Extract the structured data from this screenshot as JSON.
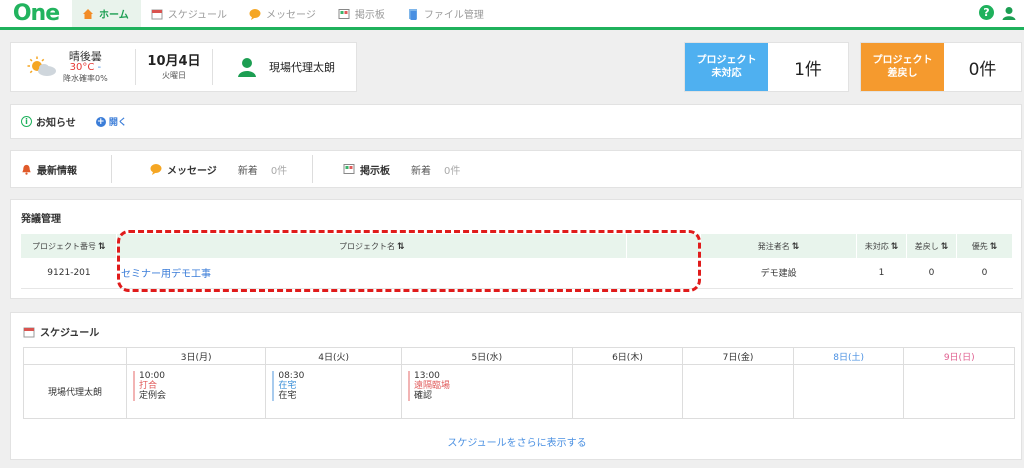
{
  "app": {
    "logo": "One"
  },
  "nav": [
    {
      "label": "ホーム",
      "icon": "home-icon",
      "active": true
    },
    {
      "label": "スケジュール",
      "icon": "calendar-icon"
    },
    {
      "label": "メッセージ",
      "icon": "chat-icon"
    },
    {
      "label": "掲示板",
      "icon": "board-icon"
    },
    {
      "label": "ファイル管理",
      "icon": "file-icon"
    }
  ],
  "weather": {
    "desc": "晴後曇",
    "temp": "30°C",
    "temp_min": "-",
    "rain": "降水確率0%"
  },
  "date": {
    "day": "10月4日",
    "weekday": "火曜日"
  },
  "user": {
    "name": "現場代理太朗"
  },
  "project_unhandled": {
    "label_line1": "プロジェクト",
    "label_line2": "未対応",
    "value": "1件",
    "color": "#4fb0f0"
  },
  "project_returned": {
    "label_line1": "プロジェクト",
    "label_line2": "差戻し",
    "value": "0件",
    "color": "#f59a2e"
  },
  "notice": {
    "title": "お知らせ",
    "open": "開く"
  },
  "latest": {
    "title": "最新情報",
    "message_label": "メッセージ",
    "message_new": "新着",
    "message_count": "0件",
    "board_label": "掲示板",
    "board_new": "新着",
    "board_count": "0件"
  },
  "orders": {
    "title": "発議管理",
    "columns": [
      "プロジェクト番号",
      "プロジェクト名",
      "",
      "発注者名",
      "未対応",
      "差戻し",
      "優先"
    ],
    "rows": [
      {
        "number": "9121-201",
        "name": "セミナー用デモ工事",
        "client": "デモ建設",
        "unhandled": "1",
        "returned": "0",
        "priority": "0"
      }
    ]
  },
  "schedule": {
    "title": "スケジュール",
    "days": [
      "3日(月)",
      "4日(火)",
      "5日(水)",
      "6日(木)",
      "7日(金)",
      "8日(土)",
      "9日(日)"
    ],
    "person": "現場代理太朗",
    "events": [
      {
        "time": "10:00",
        "tag": "打合",
        "title": "定例会",
        "tag_color": "#e05a5a"
      },
      {
        "time": "08:30",
        "tag": "在宅",
        "title": "在宅",
        "tag_color": "#3b8fd8"
      },
      {
        "time": "13:00",
        "tag": "遠隔臨場",
        "title": "確認",
        "tag_color": "#e05a5a"
      }
    ],
    "more": "スケジュールをさらに表示する"
  }
}
